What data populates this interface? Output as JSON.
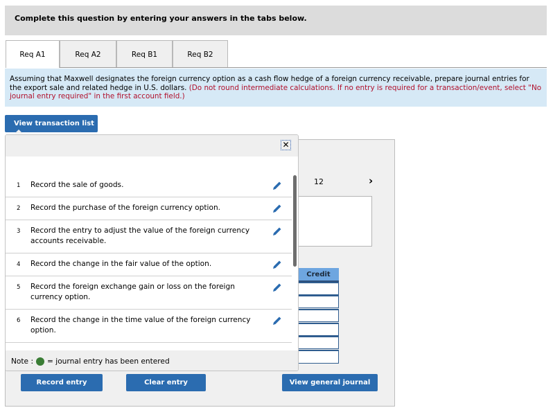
{
  "header": {
    "title": "Complete this question by entering your answers in the tabs below."
  },
  "tabs": [
    {
      "label": "Req A1",
      "active": true
    },
    {
      "label": "Req A2",
      "active": false
    },
    {
      "label": "Req B1",
      "active": false
    },
    {
      "label": "Req B2",
      "active": false
    }
  ],
  "instructions": {
    "main": "Assuming that Maxwell designates the foreign currency option as a cash flow hedge of a foreign currency receivable, prepare journal entries for the export sale and related hedge in U.S. dollars.",
    "note": "(Do not round intermediate calculations. If no entry is required for a transaction/event, select \"No journal entry required\" in the first account field.)"
  },
  "view_list_button": "View transaction list",
  "popup": {
    "close_icon": "close-icon",
    "transactions": [
      {
        "num": "1",
        "text": "Record the sale of goods."
      },
      {
        "num": "2",
        "text": "Record the purchase of the foreign currency option."
      },
      {
        "num": "3",
        "text": "Record the entry to adjust the value of the foreign currency accounts receivable."
      },
      {
        "num": "4",
        "text": "Record the change in the fair value of the option."
      },
      {
        "num": "5",
        "text": "Record the foreign exchange gain or loss on the foreign currency option."
      },
      {
        "num": "6",
        "text": "Record the change in the time value of the foreign currency option."
      }
    ],
    "note_prefix": "Note :",
    "note_suffix": "= journal entry has been entered",
    "note_color": "#3a7d35"
  },
  "journal": {
    "page_number": "12",
    "next_icon": "chevron-right-icon",
    "credit_header": "Credit",
    "credit_values": [
      "",
      "",
      "",
      "",
      "",
      ""
    ]
  },
  "buttons": {
    "record": "Record entry",
    "clear": "Clear entry",
    "general": "View general journal"
  },
  "colors": {
    "button_blue": "#2b6cb0",
    "instruction_red": "#b0102c",
    "instruction_bg": "#d6e9f6"
  }
}
